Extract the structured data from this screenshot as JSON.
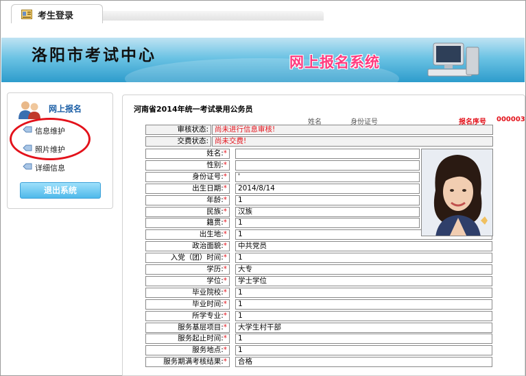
{
  "tab": {
    "title": "考生登录"
  },
  "banner": {
    "title": "洛阳市考试中心",
    "system": "网上报名系统"
  },
  "sidebar": {
    "header": "网上报名",
    "items": [
      {
        "label": "信息维护"
      },
      {
        "label": "照片维护"
      },
      {
        "label": "详细信息"
      }
    ],
    "logout": "退出系统"
  },
  "main": {
    "exam_title": "河南省2014年统一考试录用公务员",
    "peek": {
      "a": "姓名",
      "b": "身份证号",
      "c": "报名序号",
      "d": "000003"
    },
    "status": [
      {
        "label": "审核状态:",
        "value": "尚未进行信息审核!"
      },
      {
        "label": "交费状态:",
        "value": "尚未交费!"
      }
    ],
    "fields": [
      {
        "label": "姓名:",
        "value": ""
      },
      {
        "label": "性别:",
        "value": ""
      },
      {
        "label": "身份证号:",
        "value": "'"
      },
      {
        "label": "出生日期:",
        "value": "2014/8/14"
      },
      {
        "label": "年龄:",
        "value": "1"
      },
      {
        "label": "民族:",
        "value": "汉族"
      },
      {
        "label": "籍贯:",
        "value": "1"
      },
      {
        "label": "出生地:",
        "value": "1"
      },
      {
        "label": "政治面貌:",
        "value": "中共党员"
      },
      {
        "label": "入党（团）时间:",
        "value": "1"
      },
      {
        "label": "学历:",
        "value": "大专"
      },
      {
        "label": "学位:",
        "value": "学士学位"
      },
      {
        "label": "毕业院校:",
        "value": "1"
      },
      {
        "label": "毕业时间:",
        "value": "1"
      },
      {
        "label": "所学专业:",
        "value": "1"
      },
      {
        "label": "服务基层项目:",
        "value": "大学生村干部"
      },
      {
        "label": "服务起止时间:",
        "value": "1"
      },
      {
        "label": "服务地点:",
        "value": "1"
      },
      {
        "label": "服务期满考核结果:",
        "value": "合格"
      }
    ],
    "required_mark": "*"
  },
  "colors": {
    "accent": "#1c5fa6",
    "status_red": "#e3121b",
    "banner": "#2d9ccc",
    "system_pink": "#ff3b7f"
  },
  "icons": [
    "id-card-icon",
    "users-icon",
    "tag-icon",
    "computer-icon"
  ]
}
